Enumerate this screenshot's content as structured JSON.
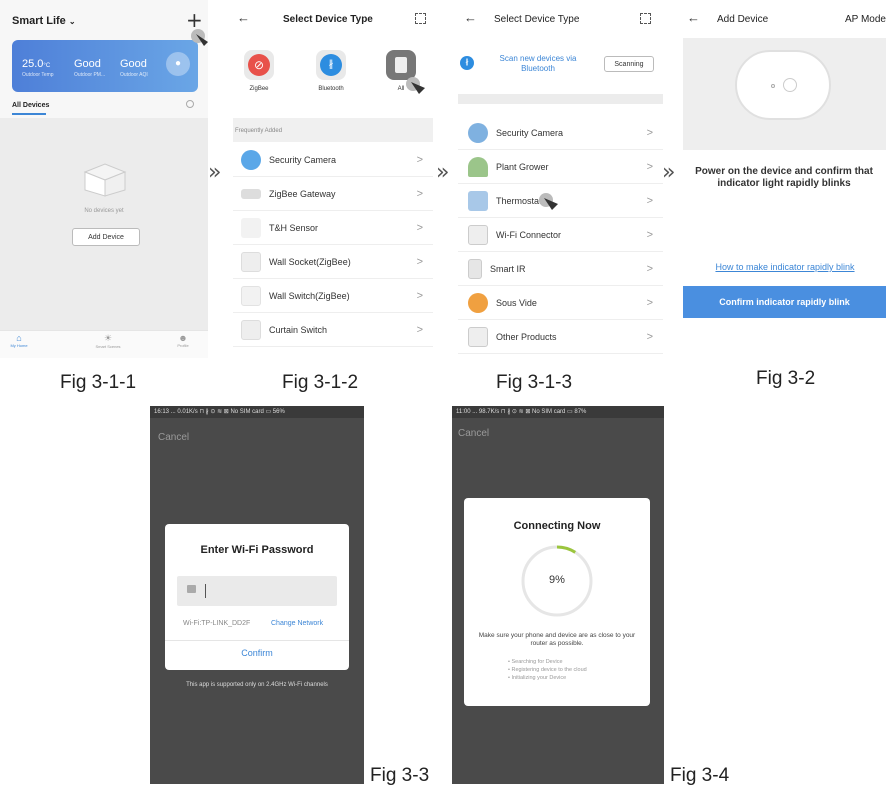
{
  "p1": {
    "title": "Smart Life",
    "weather": [
      {
        "value": "25.0",
        "unit": "°C",
        "label": "Outdoor Temp"
      },
      {
        "value": "Good",
        "unit": "",
        "label": "Outdoor PM..."
      },
      {
        "value": "Good",
        "unit": "",
        "label": "Outdoor AQI"
      }
    ],
    "tab": "All Devices",
    "empty_text": "No devices yet",
    "add_button": "Add Device",
    "nav": [
      "My Home",
      "Smart Scenes",
      "Profile"
    ]
  },
  "p2": {
    "title": "Select Device Type",
    "protocols": [
      "ZigBee",
      "Bluetooth",
      "All"
    ],
    "section": "Frequently Added",
    "items": [
      "Security Camera",
      "ZigBee Gateway",
      "T&H Sensor",
      "Wall Socket(ZigBee)",
      "Wall Switch(ZigBee)",
      "Curtain Switch"
    ]
  },
  "p3": {
    "title": "Select Device Type",
    "scan_text": "Scan new devices via Bluetooth",
    "scan_status": "Scanning",
    "items": [
      "Security Camera",
      "Plant Grower",
      "Thermostat",
      "Wi-Fi Connector",
      "Smart IR",
      "Sous Vide",
      "Other Products"
    ]
  },
  "p4": {
    "title": "Add Device",
    "mode": "AP Mode",
    "instruction": "Power on the device and confirm that indicator light rapidly blinks",
    "link": "How to make indicator rapidly blink",
    "confirm": "Confirm indicator rapidly blink"
  },
  "p5": {
    "status": "16:13 ... 0.01K/s ⊓ ∦ ⊙ ≋ ⊠ No SIM card ▭ 56%",
    "cancel": "Cancel",
    "dialog_title": "Enter Wi-Fi Password",
    "wifi_label": "Wi-Fi:TP-LINK_DD2F",
    "change_network": "Change Network",
    "confirm": "Confirm",
    "note": "This app is supported only on 2.4GHz Wi-Fi channels"
  },
  "p6": {
    "status": "11:00 ... 98.7K/s ⊓ ∦ ⊙ ≋ ⊠ No SIM card ▭ 87%",
    "cancel": "Cancel",
    "dialog_title": "Connecting Now",
    "percent": "9%",
    "progress": 0.09,
    "tip": "Make sure your phone and device are as close to your router as possible.",
    "steps": [
      "Searching for Device",
      "Registering device to the cloud",
      "Initializing your Device"
    ]
  },
  "captions": [
    "Fig 3-1-1",
    "Fig 3-1-2",
    "Fig 3-1-3",
    "Fig 3-2",
    "Fig 3-3",
    "Fig 3-4"
  ],
  "colors": {
    "accent": "#3c86d6",
    "button_blue": "#4a8fe0",
    "dark_bg": "#4a4a4a",
    "progress": "#9bc53d"
  }
}
